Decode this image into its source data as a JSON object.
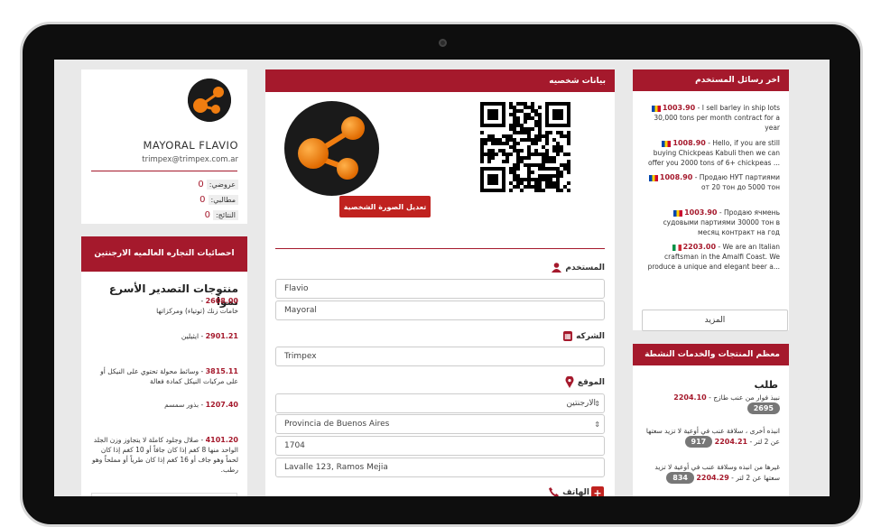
{
  "left_card": {
    "name": "MAYORAL FLAVIO",
    "email": "trimpex@trimpex.com.ar",
    "stats": [
      {
        "label": "عروضي:",
        "count": "0"
      },
      {
        "label": "مطالبي:",
        "count": "0"
      },
      {
        "label": "النتائج:",
        "count": "0"
      }
    ]
  },
  "stats_panel": {
    "header": "احصائيات التجاره العالميه الارجنتين",
    "title": "منتوجات التصدير الأسرع نمواً",
    "items": [
      {
        "value": "2608.00",
        "text": "خامات زنك (توتياء) ومركزاتها"
      },
      {
        "value": "2901.21",
        "text": "ايثيلين"
      },
      {
        "value": "3815.11",
        "text": "وسائط محولة تحتوي على النيكل أو على مركبات النيكل كمادة فعالة"
      },
      {
        "value": "1207.40",
        "text": "بذور سمسم"
      },
      {
        "value": "4101.20",
        "text": "صلال وجلود كاملة لا يتجاوز وزن الجلد الواحد منها 8 كغم إذا كان جافاً أو 10 كغم إذا كان لحماً وهو جاف أو 16 كغم إذا كان طرياً أو مملحاً وهو رطب."
      }
    ]
  },
  "center": {
    "header": "بيانات شخصيه",
    "edit_photo": "تعديل الصورة الشخصية",
    "user_label": "المستخدم",
    "first_name": "Flavio",
    "last_name": "Mayoral",
    "company_label": "الشركه",
    "company": "Trimpex",
    "location_label": "الموقع",
    "country": "الارجنتين",
    "province": "Provincia de Buenos Aires",
    "postal_code": "1704",
    "address": "Lavalle 123, Ramos Mejia",
    "phone_label": "الهاتف"
  },
  "messages": {
    "header": "اخر رسائل المستخدم",
    "items": [
      {
        "value": "1003.90",
        "text": "- I sell barley in ship lots 30,000 tons per month contract for a year",
        "flag": "md"
      },
      {
        "value": "1008.90",
        "text": "- Hello, if you are still buying Chickpeas Kabuli then we can offer you 2000 tons of 6+ chickpeas ...",
        "flag": "md"
      },
      {
        "value": "1008.90",
        "text": "- Продаю НУТ партиями от 20 тон до 5000 тон",
        "flag": "md"
      },
      {
        "value": "1003.90",
        "text": "- Продаю ячмень судовыми партиями 30000 тон в месяц контракт на год",
        "flag": "md"
      },
      {
        "value": "2203.00",
        "text": "- We are an Italian craftsman in the Amalfi Coast. We produce a unique and elegant beer a...",
        "flag": "it"
      }
    ],
    "more": "المزيد"
  },
  "products": {
    "header": "معظم المنتجات والخدمات النشطة",
    "title": "طلب",
    "items": [
      {
        "count": "2695",
        "value": "2204.10",
        "text": "نبيذ فوار من عنب طازج -"
      },
      {
        "count": "917",
        "value": "2204.21",
        "text": "انبذه أخرى ، سلافة عنب في أوعية لا تزيد سعتها عن 2 لتر -"
      },
      {
        "count": "834",
        "value": "2204.29",
        "text": "غيرها من انبذه وسلافة عنب في أوعية لا تزيد سعتها عن 2 لتر -"
      }
    ]
  },
  "colors": {
    "accent": "#a5192c",
    "button": "#c0221f",
    "logo_orange": "#f07d10"
  }
}
